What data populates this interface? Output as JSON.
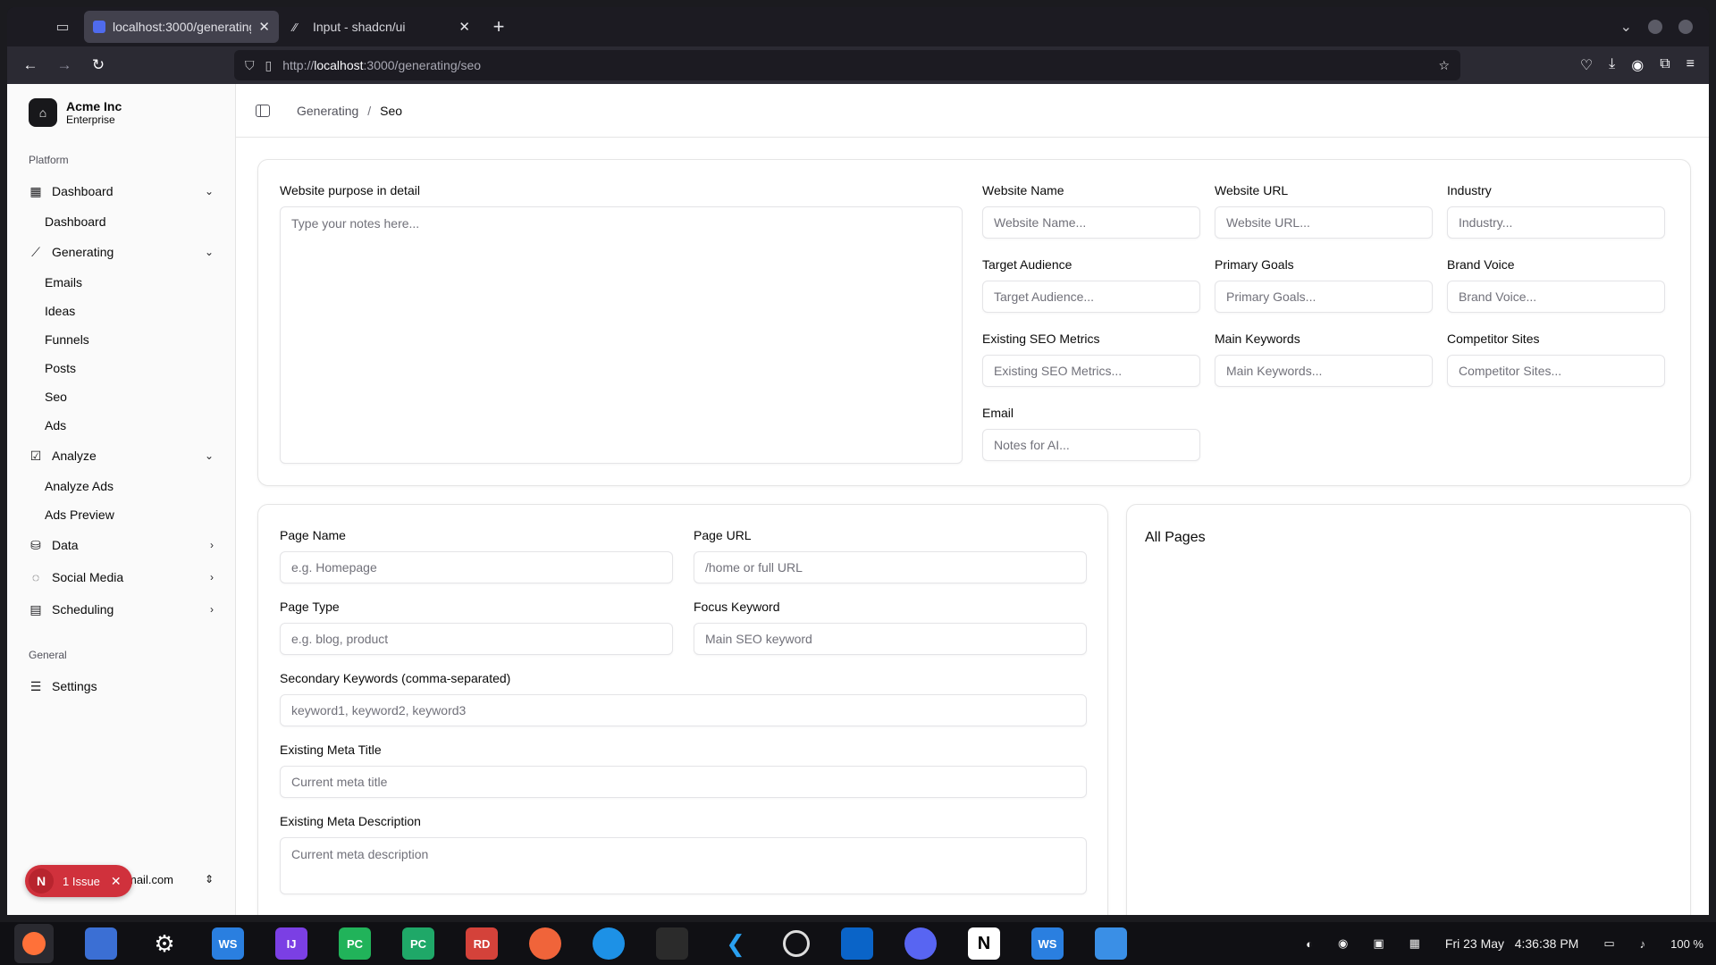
{
  "browser": {
    "tabs": [
      {
        "title": "localhost:3000/generating/",
        "active": true
      },
      {
        "title": "Input - shadcn/ui",
        "active": false
      }
    ],
    "url": {
      "scheme": "http://",
      "host": "localhost",
      "rest": ":3000/generating/seo"
    }
  },
  "sidebar": {
    "team": {
      "name": "Acme Inc",
      "plan": "Enterprise"
    },
    "group_platform": "Platform",
    "group_general": "General",
    "items": [
      {
        "label": "Dashboard",
        "icon": "dashboard-icon",
        "sub": [
          "Dashboard"
        ]
      },
      {
        "label": "Generating",
        "icon": "wand-icon",
        "sub": [
          "Emails",
          "Ideas",
          "Funnels",
          "Posts",
          "Seo",
          "Ads"
        ]
      },
      {
        "label": "Analyze",
        "icon": "checklist-icon",
        "sub": [
          "Analyze Ads",
          "Ads Preview"
        ]
      },
      {
        "label": "Data",
        "icon": "database-icon"
      },
      {
        "label": "Social Media",
        "icon": "share-icon"
      },
      {
        "label": "Scheduling",
        "icon": "calendar-icon"
      }
    ],
    "settings_label": "Settings",
    "user_email_fragment": "mail.com",
    "issue": {
      "letter": "N",
      "text": "1 Issue"
    }
  },
  "header": {
    "crumb": "Generating",
    "current": "Seo"
  },
  "website_form": {
    "purpose": {
      "label": "Website purpose in detail",
      "placeholder": "Type your notes here..."
    },
    "website_name": {
      "label": "Website Name",
      "placeholder": "Website Name..."
    },
    "website_url": {
      "label": "Website URL",
      "placeholder": "Website URL..."
    },
    "industry": {
      "label": "Industry",
      "placeholder": "Industry..."
    },
    "target_audience": {
      "label": "Target Audience",
      "placeholder": "Target Audience..."
    },
    "primary_goals": {
      "label": "Primary Goals",
      "placeholder": "Primary Goals..."
    },
    "brand_voice": {
      "label": "Brand Voice",
      "placeholder": "Brand Voice..."
    },
    "existing_seo": {
      "label": "Existing SEO Metrics",
      "placeholder": "Existing SEO Metrics..."
    },
    "main_keywords": {
      "label": "Main Keywords",
      "placeholder": "Main Keywords..."
    },
    "competitor_sites": {
      "label": "Competitor Sites",
      "placeholder": "Competitor Sites..."
    },
    "email": {
      "label": "Email",
      "placeholder": "Notes for AI..."
    }
  },
  "page_form": {
    "page_name": {
      "label": "Page Name",
      "placeholder": "e.g. Homepage"
    },
    "page_url": {
      "label": "Page URL",
      "placeholder": "/home or full URL"
    },
    "page_type": {
      "label": "Page Type",
      "placeholder": "e.g. blog, product"
    },
    "focus_keyword": {
      "label": "Focus Keyword",
      "placeholder": "Main SEO keyword"
    },
    "secondary_keywords": {
      "label": "Secondary Keywords (comma-separated)",
      "placeholder": "keyword1, keyword2, keyword3"
    },
    "meta_title": {
      "label": "Existing Meta Title",
      "placeholder": "Current meta title"
    },
    "meta_description": {
      "label": "Existing Meta Description",
      "placeholder": "Current meta description"
    }
  },
  "all_pages": {
    "title": "All Pages"
  },
  "taskbar": {
    "apps": [
      "WS",
      "IJ",
      "PC",
      "PC",
      "RD",
      "WS"
    ],
    "date": "Fri 23 May",
    "time": "4:36:38 PM",
    "battery": "100 %"
  }
}
